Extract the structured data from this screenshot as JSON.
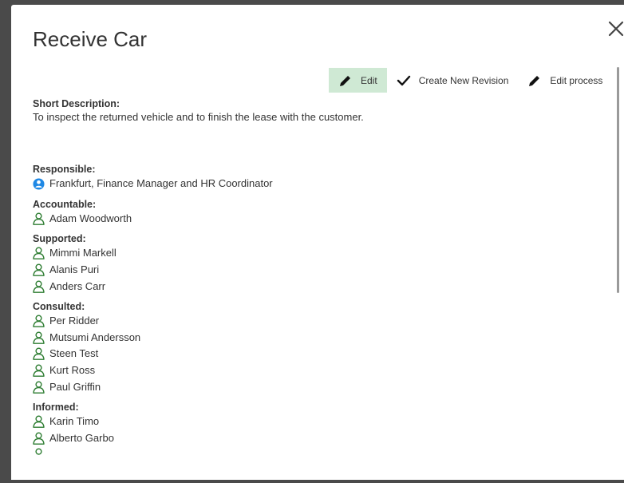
{
  "dialog": {
    "title": "Receive Car"
  },
  "toolbar": {
    "edit_label": "Edit",
    "create_revision_label": "Create New Revision",
    "edit_process_label": "Edit process"
  },
  "short_description": {
    "label": "Short Description:",
    "text": "To inspect the returned vehicle and to finish the lease with the customer."
  },
  "responsible": {
    "label": "Responsible:",
    "items": [
      "Frankfurt, Finance Manager and HR Coordinator"
    ]
  },
  "accountable": {
    "label": "Accountable:",
    "items": [
      "Adam Woodworth"
    ]
  },
  "supported": {
    "label": "Supported:",
    "items": [
      "Mimmi Markell",
      "Alanis Puri",
      "Anders Carr"
    ]
  },
  "consulted": {
    "label": "Consulted:",
    "items": [
      "Per Ridder",
      "Mutsumi Andersson",
      "Steen Test",
      "Kurt Ross",
      "Paul Griffin"
    ]
  },
  "informed": {
    "label": "Informed:",
    "items": [
      "Karin Timo",
      "Alberto Garbo"
    ]
  },
  "colors": {
    "active_button_bg": "#cfe9d4",
    "person_icon": "#2e7d32",
    "group_icon": "#1e88e5"
  },
  "icons": {
    "close": "close-icon",
    "edit": "pencil-icon",
    "revision": "checkmark-icon",
    "person": "person-icon",
    "group": "group-icon"
  }
}
